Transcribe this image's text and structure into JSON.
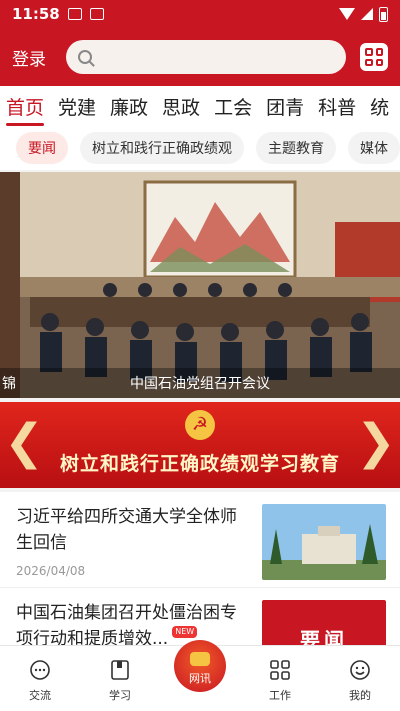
{
  "status": {
    "time": "11:58"
  },
  "header": {
    "login_label": "登录",
    "search_placeholder": ""
  },
  "tabs": [
    {
      "label": "首页"
    },
    {
      "label": "党建"
    },
    {
      "label": "廉政"
    },
    {
      "label": "思政"
    },
    {
      "label": "工会"
    },
    {
      "label": "团青"
    },
    {
      "label": "科普"
    },
    {
      "label": "统"
    }
  ],
  "chips": [
    {
      "label": "要闻"
    },
    {
      "label": "树立和践行正确政绩观"
    },
    {
      "label": "主题教育"
    },
    {
      "label": "媒体"
    }
  ],
  "banner": {
    "prev_caption": "锦",
    "caption": "中国石油党组召开会议"
  },
  "promo": {
    "text": "树立和践行正确政绩观学习教育"
  },
  "news": [
    {
      "title": "习近平给四所交通大学全体师生回信",
      "date": "2026/04/08",
      "badge": ""
    },
    {
      "title": "中国石油集团召开处僵治困专项行动和提质增效...",
      "date": "",
      "badge": "NEW",
      "thumb_text": "要闻"
    }
  ],
  "bottom_nav": [
    {
      "label": "交流",
      "icon": "chat-icon"
    },
    {
      "label": "学习",
      "icon": "book-icon"
    },
    {
      "label": "网讯",
      "icon": "party-emblem-icon"
    },
    {
      "label": "工作",
      "icon": "grid-icon"
    },
    {
      "label": "我的",
      "icon": "smiley-icon"
    }
  ],
  "colors": {
    "brand_red": "#c81623",
    "accent_gold": "#f6c443"
  }
}
